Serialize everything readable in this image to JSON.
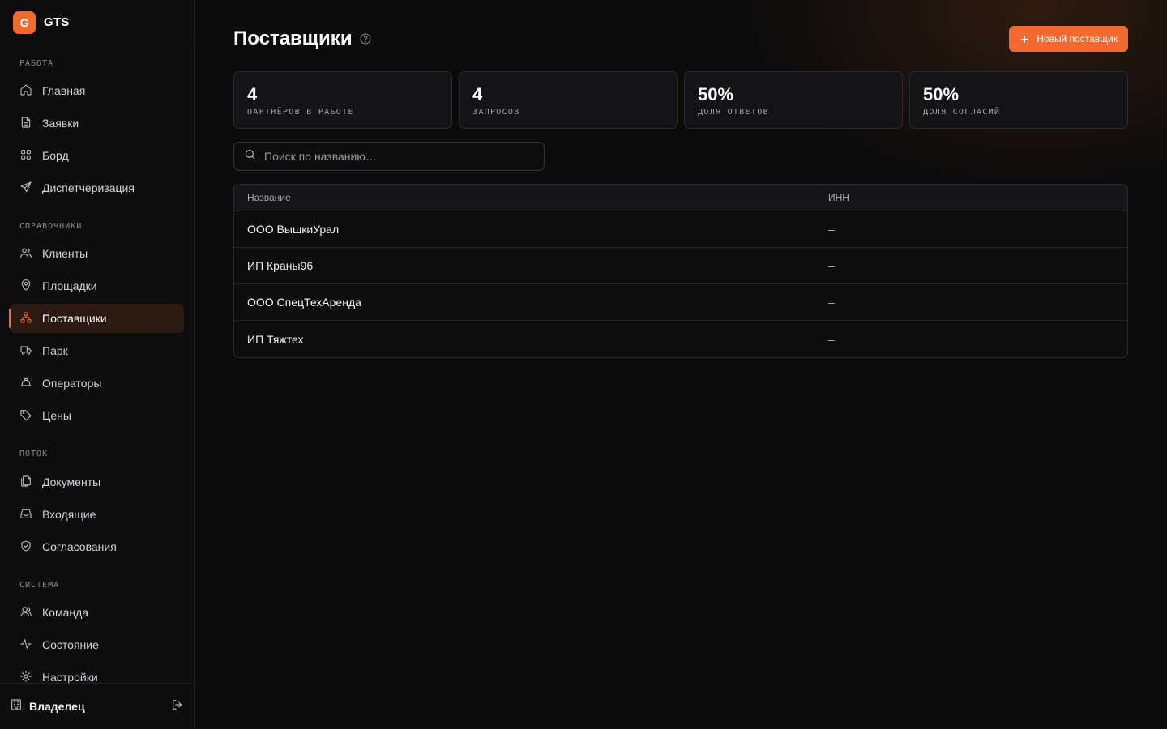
{
  "brand": {
    "logo_letter": "G",
    "name": "GTS",
    "accent": "#f26a2e"
  },
  "sidebar": {
    "sections": [
      {
        "title": "РАБОТА",
        "items": [
          {
            "label": "Главная",
            "icon": "home-icon"
          },
          {
            "label": "Заявки",
            "icon": "file-icon"
          },
          {
            "label": "Борд",
            "icon": "grid-icon"
          },
          {
            "label": "Диспетчеризация",
            "icon": "send-icon"
          }
        ]
      },
      {
        "title": "СПРАВОЧНИКИ",
        "items": [
          {
            "label": "Клиенты",
            "icon": "users-icon"
          },
          {
            "label": "Площадки",
            "icon": "map-pin-icon"
          },
          {
            "label": "Поставщики",
            "icon": "network-icon",
            "active": true
          },
          {
            "label": "Парк",
            "icon": "truck-icon"
          },
          {
            "label": "Операторы",
            "icon": "hard-hat-icon"
          },
          {
            "label": "Цены",
            "icon": "tag-icon"
          }
        ]
      },
      {
        "title": "ПОТОК",
        "items": [
          {
            "label": "Документы",
            "icon": "documents-icon"
          },
          {
            "label": "Входящие",
            "icon": "inbox-icon"
          },
          {
            "label": "Согласования",
            "icon": "shield-check-icon"
          }
        ]
      },
      {
        "title": "СИСТЕМА",
        "items": [
          {
            "label": "Команда",
            "icon": "team-icon"
          },
          {
            "label": "Состояние",
            "icon": "activity-icon"
          },
          {
            "label": "Настройки",
            "icon": "gear-icon"
          }
        ]
      }
    ],
    "footer": {
      "label": "Владелец",
      "icon": "building-icon",
      "logout_icon": "logout-icon"
    }
  },
  "page": {
    "title": "Поставщики",
    "new_button": "Новый поставщик"
  },
  "stats": [
    {
      "value": "4",
      "label": "ПАРТНЁРОВ В РАБОТЕ"
    },
    {
      "value": "4",
      "label": "ЗАПРОСОВ"
    },
    {
      "value": "50%",
      "label": "ДОЛЯ ОТВЕТОВ"
    },
    {
      "value": "50%",
      "label": "ДОЛЯ СОГЛАСИЙ"
    }
  ],
  "search": {
    "placeholder": "Поиск по названию…",
    "value": ""
  },
  "table": {
    "columns": [
      "Название",
      "ИНН"
    ],
    "rows": [
      {
        "name": "ООО ВышкиУрал",
        "inn": "–"
      },
      {
        "name": "ИП Краны96",
        "inn": "–"
      },
      {
        "name": "ООО СпецТехАренда",
        "inn": "–"
      },
      {
        "name": "ИП Тяжтех",
        "inn": "–"
      }
    ]
  }
}
